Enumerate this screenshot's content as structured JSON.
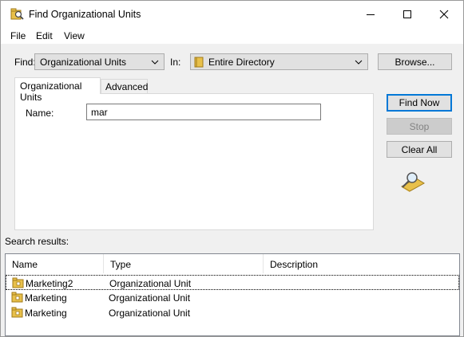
{
  "window": {
    "title": "Find Organizational Units",
    "icon": "find-folder-icon"
  },
  "caption_buttons": {
    "minimize": "minimize-icon",
    "maximize": "maximize-icon",
    "close": "close-icon"
  },
  "menu": {
    "items": [
      "File",
      "Edit",
      "View"
    ]
  },
  "find_row": {
    "find_label": "Find:",
    "find_value": "Organizational Units",
    "in_label": "In:",
    "in_value": "Entire Directory",
    "browse_label": "Browse..."
  },
  "tabs": [
    {
      "label": "Organizational Units",
      "active": true
    },
    {
      "label": "Advanced",
      "active": false
    }
  ],
  "form": {
    "name_label": "Name:",
    "name_value": "mar"
  },
  "actions": {
    "find_now": "Find Now",
    "stop": "Stop",
    "clear_all": "Clear All",
    "search_graphic": "magnifier-folder-icon"
  },
  "results": {
    "label": "Search results:",
    "columns": [
      "Name",
      "Type",
      "Description"
    ],
    "rows": [
      {
        "name": "Marketing2",
        "type": "Organizational Unit",
        "description": ""
      },
      {
        "name": "Marketing",
        "type": "Organizational Unit",
        "description": ""
      },
      {
        "name": "Marketing",
        "type": "Organizational Unit",
        "description": ""
      }
    ]
  },
  "colors": {
    "accent": "#0078d7",
    "folder": "#e8c04a"
  }
}
